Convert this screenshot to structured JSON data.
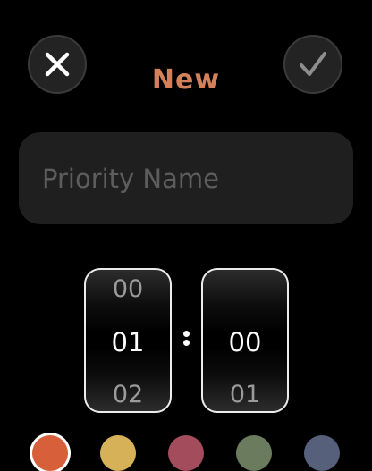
{
  "header": {
    "title": "New",
    "cancel_icon": "close-icon",
    "confirm_icon": "checkmark-icon"
  },
  "name_input": {
    "placeholder": "Priority Name",
    "value": ""
  },
  "time_picker": {
    "hour": {
      "prev": "00",
      "current": "01",
      "next": "02"
    },
    "minute": {
      "prev": "",
      "current": "00",
      "next": "01"
    },
    "separator": ":"
  },
  "colors": {
    "accent": "#d4805b",
    "swatches": [
      "#d7603a",
      "#d7b157",
      "#a34c5c",
      "#6b7b5e",
      "#56607a"
    ]
  }
}
